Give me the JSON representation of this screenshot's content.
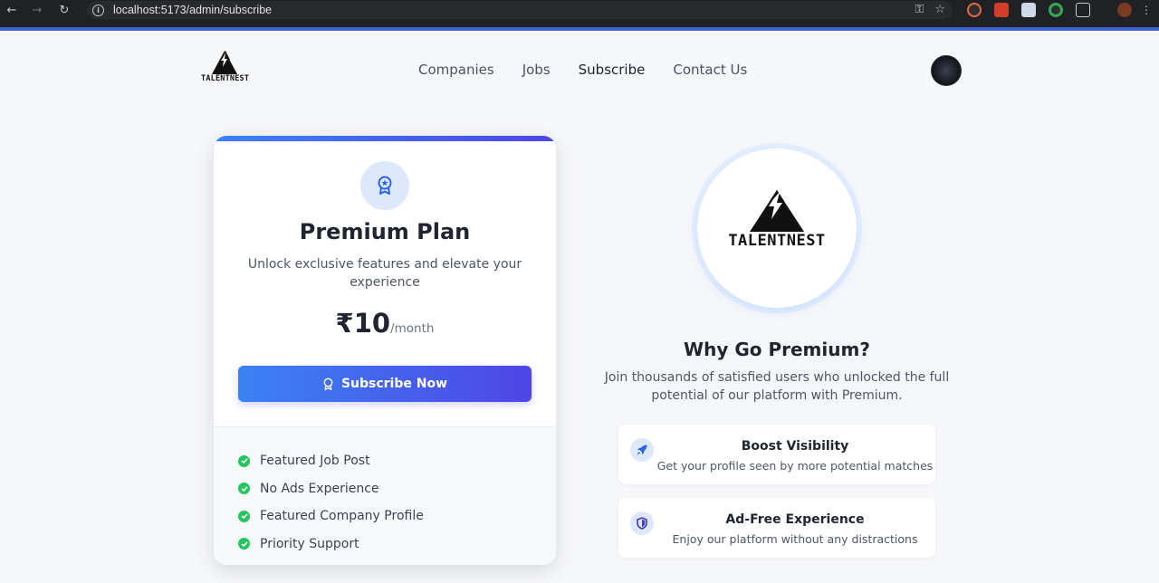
{
  "browser": {
    "url": "localhost:5173/admin/subscribe"
  },
  "brand": {
    "name": "TALENTNEST"
  },
  "nav": {
    "items": [
      "Companies",
      "Jobs",
      "Subscribe",
      "Contact Us"
    ],
    "active": "Subscribe"
  },
  "plan": {
    "title": "Premium Plan",
    "description": "Unlock exclusive features and elevate your experience",
    "price": "₹10",
    "period": "/month",
    "cta": "Subscribe Now",
    "features": [
      "Featured Job Post",
      "No Ads Experience",
      "Featured Company Profile",
      "Priority Support"
    ]
  },
  "why": {
    "title": "Why Go Premium?",
    "description": "Join thousands of satisfied users who unlocked the full potential of our platform with Premium.",
    "benefits": [
      {
        "title": "Boost Visibility",
        "desc": "Get your profile seen by more potential matches",
        "icon": "rocket-icon"
      },
      {
        "title": "Ad-Free Experience",
        "desc": "Enjoy our platform without any distractions",
        "icon": "shield-icon"
      }
    ]
  },
  "colors": {
    "accent_start": "#3b82f6",
    "accent_end": "#4f46e5",
    "check": "#22c55e"
  }
}
